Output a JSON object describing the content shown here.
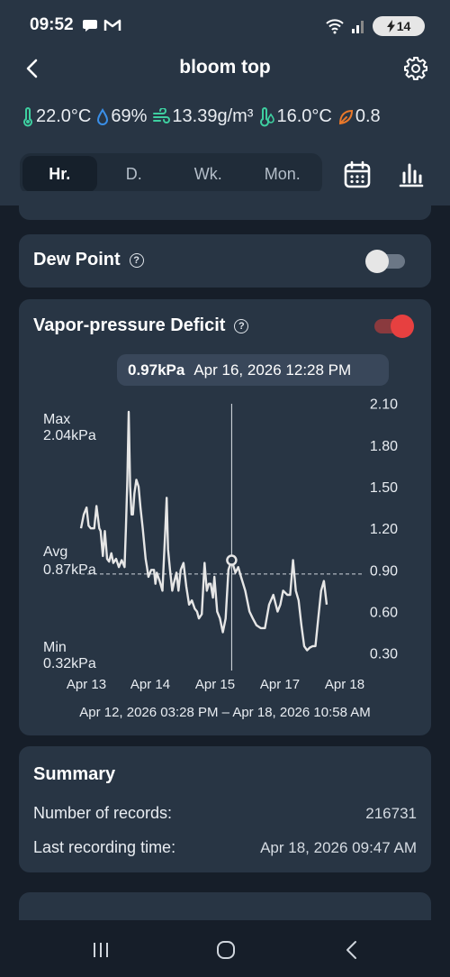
{
  "status_bar": {
    "time": "09:52",
    "battery": "14",
    "icons": [
      "message-icon",
      "gmail-icon",
      "wifi-icon",
      "signal-icon",
      "battery-charging-icon"
    ]
  },
  "header": {
    "title": "bloom top",
    "back_icon": "chevron-left-icon",
    "settings_icon": "gear-icon"
  },
  "metrics": [
    {
      "icon": "thermometer-icon",
      "value": "22.0°C",
      "color": "#3ecfa0"
    },
    {
      "icon": "water-drop-icon",
      "value": "69%",
      "color": "#3a8fe8"
    },
    {
      "icon": "wind-icon",
      "value": "13.39g/m³",
      "color": "#3ecfa0"
    },
    {
      "icon": "dew-point-icon",
      "value": "16.0°C",
      "color": "#3ecfa0"
    },
    {
      "icon": "leaf-icon",
      "value": "0.8",
      "color": "#e8782a"
    }
  ],
  "tabs": [
    "Hr.",
    "D.",
    "Wk.",
    "Mon."
  ],
  "active_tab": 0,
  "dew_point": {
    "title": "Dew Point",
    "enabled": false
  },
  "vpd": {
    "title": "Vapor-pressure Deficit",
    "enabled": true,
    "tooltip_value": "0.97kPa",
    "tooltip_time": "Apr 16, 2026 12:28 PM",
    "range": "Apr 12, 2026 03:28 PM – Apr 18, 2026 10:58 AM"
  },
  "chart_data": {
    "type": "line",
    "title": "Vapor-pressure Deficit",
    "unit": "kPa",
    "ylim": [
      0.2,
      2.15
    ],
    "y_ticks": [
      "2.10",
      "1.80",
      "1.50",
      "1.20",
      "0.90",
      "0.60",
      "0.30"
    ],
    "x_ticks": [
      "Apr 13",
      "Apr 14",
      "Apr 15",
      "Apr 17",
      "Apr 18"
    ],
    "stats": {
      "max_label": "Max",
      "max": "2.04kPa",
      "avg_label": "Avg",
      "avg": "0.87kPa",
      "min_label": "Min",
      "min": "0.32kPa"
    },
    "avg": 0.87,
    "cursor_x": 0.5365,
    "cursor_y": 0.97,
    "x": [
      0.0,
      0.01,
      0.02,
      0.027,
      0.035,
      0.04,
      0.047,
      0.055,
      0.065,
      0.07,
      0.078,
      0.085,
      0.093,
      0.1,
      0.108,
      0.115,
      0.125,
      0.135,
      0.145,
      0.155,
      0.16,
      0.165,
      0.17,
      0.175,
      0.18,
      0.185,
      0.19,
      0.197,
      0.205,
      0.212,
      0.22,
      0.23,
      0.235,
      0.24,
      0.25,
      0.26,
      0.265,
      0.27,
      0.28,
      0.29,
      0.3,
      0.305,
      0.31,
      0.317,
      0.325,
      0.33,
      0.34,
      0.347,
      0.355,
      0.365,
      0.375,
      0.385,
      0.395,
      0.405,
      0.413,
      0.42,
      0.43,
      0.44,
      0.448,
      0.455,
      0.462,
      0.47,
      0.475,
      0.485,
      0.495,
      0.505,
      0.515,
      0.525,
      0.5365,
      0.55,
      0.56,
      0.57,
      0.585,
      0.6,
      0.612,
      0.625,
      0.64,
      0.655,
      0.67,
      0.685,
      0.7,
      0.71,
      0.72,
      0.735,
      0.745,
      0.755,
      0.765,
      0.775,
      0.785,
      0.795,
      0.805,
      0.815,
      0.825,
      0.835,
      0.845,
      0.855,
      0.865,
      0.875
    ],
    "y": [
      1.2,
      1.3,
      1.35,
      1.22,
      1.2,
      1.2,
      1.2,
      1.36,
      1.2,
      1.18,
      1.0,
      1.18,
      0.98,
      0.96,
      1.02,
      0.95,
      0.98,
      0.92,
      0.97,
      0.92,
      1.2,
      1.55,
      2.04,
      1.5,
      1.3,
      1.3,
      1.45,
      1.55,
      1.5,
      1.35,
      1.2,
      0.98,
      0.92,
      0.85,
      0.9,
      0.9,
      0.8,
      0.88,
      0.82,
      0.75,
      1.18,
      1.42,
      1.05,
      0.9,
      0.75,
      0.8,
      0.88,
      0.75,
      0.9,
      0.95,
      0.78,
      0.65,
      0.68,
      0.62,
      0.6,
      0.55,
      0.58,
      0.95,
      0.75,
      0.8,
      0.8,
      0.7,
      0.85,
      0.6,
      0.55,
      0.45,
      0.55,
      0.9,
      0.97,
      0.88,
      0.92,
      0.85,
      0.75,
      0.6,
      0.55,
      0.5,
      0.48,
      0.48,
      0.65,
      0.72,
      0.6,
      0.65,
      0.75,
      0.72,
      0.72,
      0.97,
      0.75,
      0.68,
      0.5,
      0.35,
      0.32,
      0.34,
      0.35,
      0.35,
      0.55,
      0.75,
      0.82,
      0.65
    ]
  },
  "summary": {
    "title": "Summary",
    "rows": [
      {
        "label": "Number of records:",
        "value": "216731"
      },
      {
        "label": "Last recording time:",
        "value": "Apr 18, 2026 09:47 AM"
      }
    ]
  },
  "colors": {
    "accent": "#e74040",
    "card": "#283544",
    "background": "#161e29",
    "line": "#e6e6e6"
  },
  "nav": [
    "recent-apps-icon",
    "home-icon",
    "back-icon"
  ]
}
